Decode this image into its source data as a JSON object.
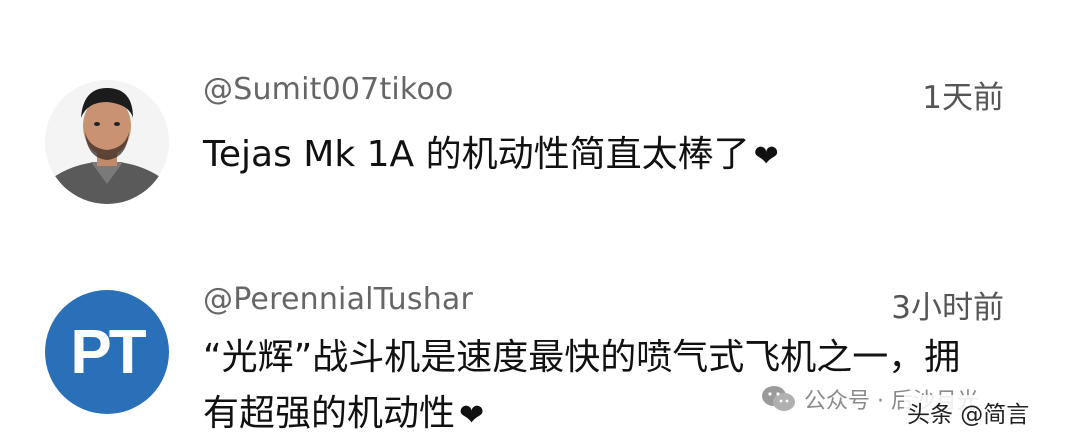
{
  "comments": [
    {
      "username": "@Sumit007tikoo",
      "time": "1天前",
      "text": "Tejas Mk 1A 的机动性简直太棒了",
      "reaction_icon": "heart-icon"
    },
    {
      "username": "@PerennialTushar",
      "time": "3小时前",
      "avatar_initials": "PT",
      "avatar_color": "#2a70b8",
      "text": "“光辉”战斗机是速度最快的喷气式飞机之一，拥有超强的机动性",
      "reaction_icon": "heart-icon"
    }
  ],
  "watermark": {
    "text": "公众号 · 后沙月光",
    "overlay": "头条 @简言"
  }
}
